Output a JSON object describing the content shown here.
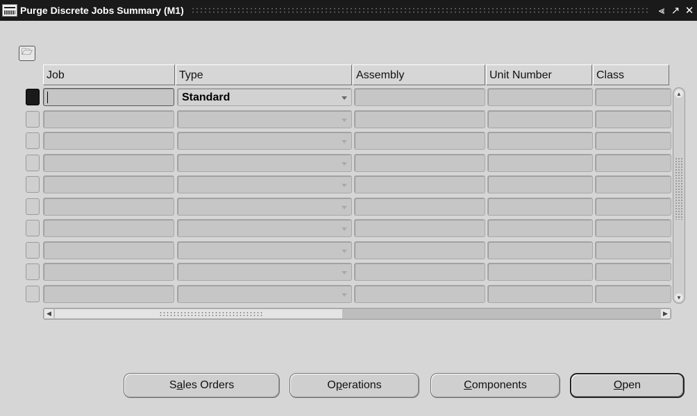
{
  "window": {
    "title": "Purge Discrete Jobs Summary (M1)",
    "icon": "oracle-app-icon",
    "controls": [
      "minimize-icon",
      "maximize-icon",
      "close-icon"
    ]
  },
  "toolbar": {
    "folder_icon": "folder-open-icon"
  },
  "grid": {
    "columns": [
      "Job",
      "Type",
      "Assembly",
      "Unit Number",
      "Class"
    ],
    "rows": [
      {
        "job": "",
        "type": "Standard",
        "assembly": "",
        "unit_number": "",
        "class": ""
      },
      {
        "job": "",
        "type": "",
        "assembly": "",
        "unit_number": "",
        "class": ""
      },
      {
        "job": "",
        "type": "",
        "assembly": "",
        "unit_number": "",
        "class": ""
      },
      {
        "job": "",
        "type": "",
        "assembly": "",
        "unit_number": "",
        "class": ""
      },
      {
        "job": "",
        "type": "",
        "assembly": "",
        "unit_number": "",
        "class": ""
      },
      {
        "job": "",
        "type": "",
        "assembly": "",
        "unit_number": "",
        "class": ""
      },
      {
        "job": "",
        "type": "",
        "assembly": "",
        "unit_number": "",
        "class": ""
      },
      {
        "job": "",
        "type": "",
        "assembly": "",
        "unit_number": "",
        "class": ""
      },
      {
        "job": "",
        "type": "",
        "assembly": "",
        "unit_number": "",
        "class": ""
      },
      {
        "job": "",
        "type": "",
        "assembly": "",
        "unit_number": "",
        "class": ""
      }
    ]
  },
  "buttons": {
    "sales_orders": {
      "pre": "S",
      "mnemonic": "a",
      "post": "les Orders"
    },
    "operations": {
      "pre": "O",
      "mnemonic": "p",
      "post": "erations"
    },
    "components": {
      "pre": "",
      "mnemonic": "C",
      "post": "omponents"
    },
    "open": {
      "pre": "",
      "mnemonic": "O",
      "post": "pen"
    }
  }
}
